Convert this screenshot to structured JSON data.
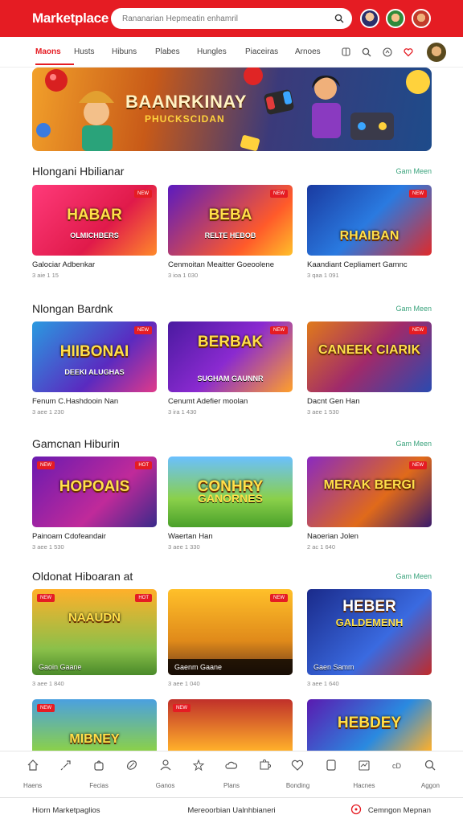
{
  "header": {
    "brand": "Marketplace",
    "search_placeholder": "Rananarian Hepmeatin enhamril",
    "accent": "#e51c23"
  },
  "nav": {
    "tabs": [
      {
        "label": "Maons",
        "active": true
      },
      {
        "label": "Husts"
      },
      {
        "label": "Hibuns"
      },
      {
        "label": "Plabes"
      },
      {
        "label": "Hungles"
      },
      {
        "label": "Piaceiras"
      },
      {
        "label": "Arnoes"
      }
    ],
    "icons": [
      "grid-icon",
      "search-icon",
      "globe-icon",
      "heart-icon"
    ]
  },
  "banner": {
    "title": "BAANRKINAY",
    "subtitle": "PHUCKSCIDAN"
  },
  "sections": [
    {
      "title": "Hlongani Hbilianar",
      "see_all": "Gam Meen",
      "cards": [
        {
          "thumb_title": "HABAR",
          "thumb_sub": "OLMICHBERS",
          "badge": "",
          "name": "Galociar Adbenkar",
          "meta": "3 aie 1 15"
        },
        {
          "thumb_title": "BEBA",
          "thumb_sub": "RELTE HEBOB",
          "badge": "",
          "name": "Cenmoitan Meaitter Goeoolene",
          "meta": "3 ioa 1 030"
        },
        {
          "thumb_title": "RHAIBAN",
          "thumb_sub": "",
          "badge": "",
          "name": "Kaandiant Cepliamert Gamnc",
          "meta": "3 qaa 1 091"
        }
      ]
    },
    {
      "title": "Nlongan Bardnk",
      "see_all": "Gam Meen",
      "cards": [
        {
          "thumb_title": "HIIBONAI",
          "thumb_sub": "DEEKI ALUGHAS",
          "badge": "",
          "name": "Fenum C.Hashdooin Nan",
          "meta": "3 aee 1 230"
        },
        {
          "thumb_title": "BERBAK",
          "thumb_sub": "SUGHAM GAUNNR",
          "badge": "",
          "name": "Cenumt Adefier moolan",
          "meta": "3 ira 1 430"
        },
        {
          "thumb_title": "CANEEK CIARIK",
          "thumb_sub": "",
          "badge": "",
          "name": "Dacnt Gen Han",
          "meta": "3 aee 1 530"
        }
      ]
    },
    {
      "title": "Gamcnan Hiburin",
      "see_all": "Gam Meen",
      "cards": [
        {
          "thumb_title": "HOPOAIS",
          "thumb_sub": "",
          "badge": "",
          "name": "Painoam Cdofeandair",
          "meta": "3 aee 1 530"
        },
        {
          "thumb_title": "CONHRY",
          "thumb_sub": "GANORNES",
          "badge": "",
          "name": "Waertan Han",
          "meta": "3 aee 1 330"
        },
        {
          "thumb_title": "MERAK BERGI",
          "thumb_sub": "",
          "badge": "",
          "name": "Naoerian Jolen",
          "meta": "2 ac 1 640"
        }
      ]
    },
    {
      "title": "Oldonat Hiboaran at",
      "see_all": "Gam Meen",
      "cards": [
        {
          "thumb_title": "NAAUDN",
          "thumb_sub": "",
          "badge": "",
          "overlay": "Gaoin Gaane",
          "name": "",
          "meta": "3 aee 1 840"
        },
        {
          "thumb_title": "",
          "thumb_sub": "",
          "badge": "",
          "overlay": "Gaenm Gaane",
          "name": "",
          "meta": "3 aee 1 040"
        },
        {
          "thumb_title": "HEBER",
          "thumb_sub": "GALDEMENH",
          "badge": "",
          "overlay": "Gaen Samm",
          "name": "",
          "meta": "3 aee 1 640"
        }
      ]
    }
  ],
  "partial_row": [
    {
      "thumb_title": "MIBNEY"
    },
    {
      "thumb_title": ""
    },
    {
      "thumb_title": "HEBDEY"
    }
  ],
  "bottom_nav": [
    {
      "icon": "home-icon",
      "label": "Haens"
    },
    {
      "icon": "rocket-icon",
      "label": ""
    },
    {
      "icon": "bag-icon",
      "label": "Fecias"
    },
    {
      "icon": "ball-icon",
      "label": ""
    },
    {
      "icon": "user-icon",
      "label": "Ganos"
    },
    {
      "icon": "star-icon",
      "label": ""
    },
    {
      "icon": "cloud-icon",
      "label": "Plans"
    },
    {
      "icon": "puzzle-icon",
      "label": ""
    },
    {
      "icon": "heart-icon",
      "label": "Bonding"
    },
    {
      "icon": "cards-icon",
      "label": ""
    },
    {
      "icon": "chart-icon",
      "label": "Hacnes"
    },
    {
      "icon": "cd-icon",
      "label": ""
    },
    {
      "icon": "search-icon",
      "label": "Aggon"
    }
  ],
  "footer": {
    "left": "Hiorn Marketpaglios",
    "middle": "Mereoorbian Ualnhbianeri",
    "right": "Cemngon Mepnan"
  }
}
